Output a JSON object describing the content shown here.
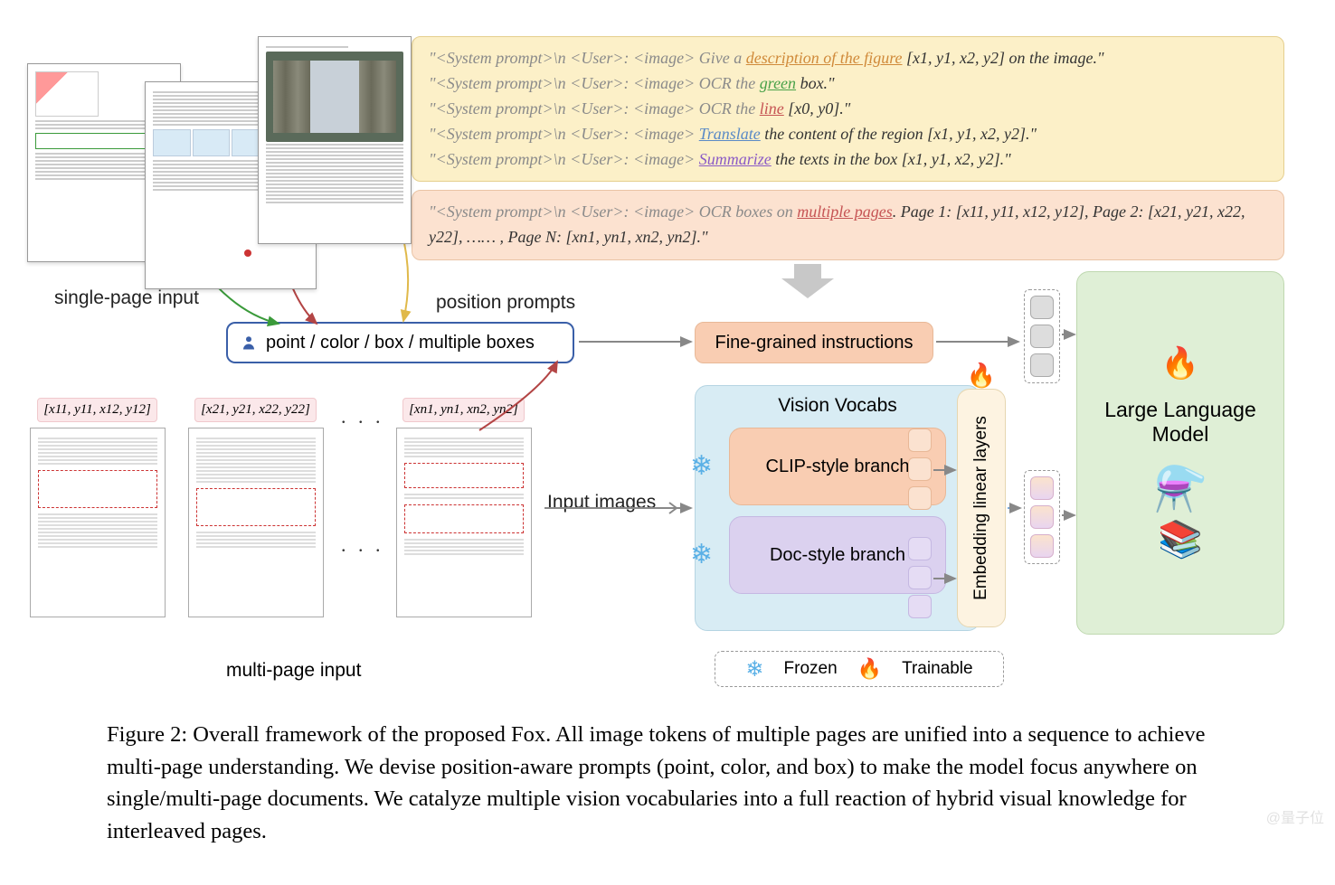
{
  "diagram": {
    "single_page_label": "single-page input",
    "multi_page_label": "multi-page input",
    "position_prompts_label": "position prompts",
    "input_images_label": "Input images",
    "capsule": {
      "text": "point / color / box / multiple boxes"
    },
    "fine_grained": "Fine-grained instructions",
    "vision_vocabs": {
      "title": "Vision Vocabs",
      "clip_branch": "CLIP-style branch",
      "doc_branch": "Doc-style branch"
    },
    "embedding": "Embedding linear layers",
    "llm": "Large Language Model",
    "legend": {
      "frozen": "Frozen",
      "trainable": "Trainable"
    },
    "multipage": {
      "coords": [
        "[x11, y11, x12, y12]",
        "[x21, y21, x22, y22]",
        "[xn1, yn1, xn2, yn2]"
      ],
      "ellipsis": ". . ."
    }
  },
  "prompts": {
    "p1_a": "\"<System prompt>\\n <User>: <image> Give a ",
    "p1_kw": "description of the figure",
    "p1_b": " [x1, y1, x2, y2] on the image.\"",
    "p2_a": "\"<System prompt>\\n <User>: <image> OCR the ",
    "p2_kw": "green",
    "p2_b": " box.\"",
    "p3_a": "\"<System prompt>\\n <User>: <image> OCR the ",
    "p3_kw": "line",
    "p3_b": " [x0, y0].\"",
    "p4_a": "\"<System prompt>\\n <User>: <image> ",
    "p4_kw": "Translate",
    "p4_b": " the content of the region [x1, y1, x2, y2].\"",
    "p5_a": "\"<System prompt>\\n <User>: <image> ",
    "p5_kw": "Summarize",
    "p5_b": " the texts in the box [x1, y1, x2, y2].\"",
    "mp_a": "\"<System prompt>\\n <User>: <image> OCR boxes on ",
    "mp_kw": "multiple pages",
    "mp_b": ". Page 1: [x11, y11, x12, y12], Page 2: [x21, y21, x22, y22], …… , Page N: [xn1, yn1, xn2, yn2].\""
  },
  "caption": {
    "text": "Figure 2: Overall framework of the proposed Fox. All image tokens of multiple pages are unified into a sequence to achieve multi-page understanding. We devise position-aware prompts (point, color, and box) to make the model focus anywhere on single/multi-page documents. We catalyze multiple vision vocabularies into a full reaction of hybrid visual knowledge for interleaved pages."
  },
  "icons": {
    "snowflake": "❄",
    "flame": "🔥",
    "books": "📚",
    "flask": "⚗️"
  },
  "watermark": "@量子位"
}
